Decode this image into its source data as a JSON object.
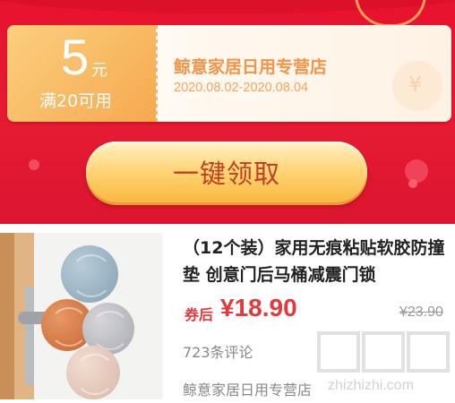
{
  "coupon": {
    "amount": "5",
    "unit": "元",
    "condition": "满20可用",
    "store": "鲸意家居日用专营店",
    "dates": "2020.08.02-2020.08.04",
    "claim_label": "一键领取",
    "colors": {
      "banner": "#e51a33",
      "coupon_left": "#f6a94f",
      "store_text": "#f39448",
      "button_text": "#c04022"
    }
  },
  "product": {
    "title": "（12个装）家用无痕粘贴软胶防撞垫 创意门后马桶减震门锁",
    "price_label": "券后",
    "price": "¥18.90",
    "original_price": "¥23.90",
    "reviews": "723条评论",
    "store": "鲸意家居日用专营店",
    "price_color": "#e4393c"
  },
  "watermark": {
    "logo": "值值值",
    "site": "zhizhizhi.com"
  }
}
